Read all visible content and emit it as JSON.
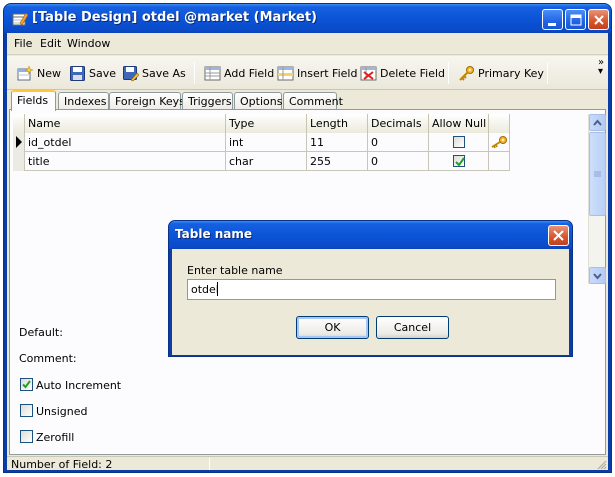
{
  "window": {
    "title": "[Table Design] otdel @market (Market)"
  },
  "menu": [
    "File",
    "Edit",
    "Window"
  ],
  "toolbar": {
    "new": "New",
    "save": "Save",
    "save_as": "Save As",
    "add_field": "Add Field",
    "insert_field": "Insert Field",
    "delete_field": "Delete Field",
    "primary_key": "Primary Key",
    "more": "»"
  },
  "tabs": [
    "Fields",
    "Indexes",
    "Foreign Keys",
    "Triggers",
    "Options",
    "Comment"
  ],
  "active_tab": "Fields",
  "grid": {
    "columns": [
      "Name",
      "Type",
      "Length",
      "Decimals",
      "Allow Null"
    ],
    "rows": [
      {
        "name": "id_otdel",
        "type": "int",
        "length": "11",
        "decimals": "0",
        "allow_null": false,
        "primary_key": true,
        "current": true
      },
      {
        "name": "title",
        "type": "char",
        "length": "255",
        "decimals": "0",
        "allow_null": true,
        "primary_key": false,
        "current": false
      }
    ]
  },
  "field_options": {
    "default_label": "Default:",
    "comment_label": "Comment:",
    "auto_increment": {
      "label": "Auto Increment",
      "checked": true
    },
    "unsigned": {
      "label": "Unsigned",
      "checked": false
    },
    "zerofill": {
      "label": "Zerofill",
      "checked": false
    }
  },
  "status": {
    "text": "Number of Field: 2"
  },
  "dialog": {
    "title": "Table name",
    "prompt": "Enter table name",
    "value": "otdel",
    "ok": "OK",
    "cancel": "Cancel"
  },
  "colors": {
    "titlebar": "#0b54d8",
    "face": "#ece9d8",
    "close_button": "#d9582f",
    "key_icon": "#e6a100"
  }
}
